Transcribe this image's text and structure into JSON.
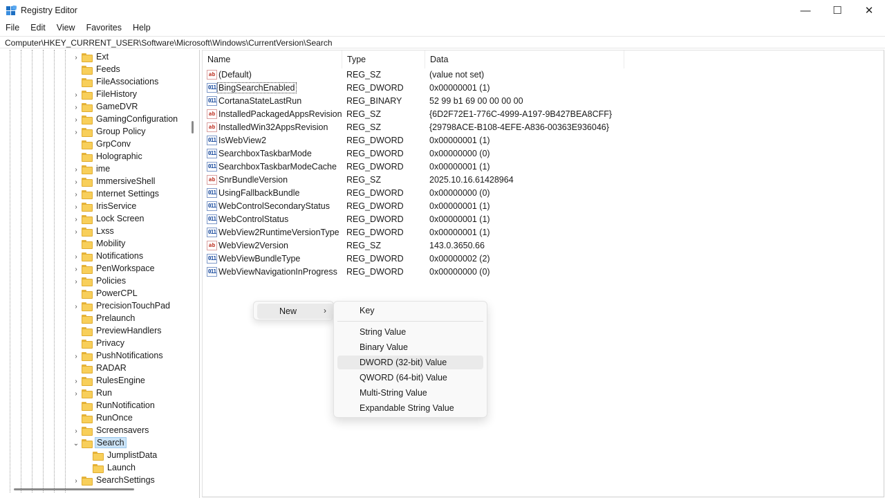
{
  "window": {
    "title": "Registry Editor",
    "controls": {
      "minimize": "—",
      "maximize": "☐",
      "close": "✕"
    }
  },
  "menubar": [
    "File",
    "Edit",
    "View",
    "Favorites",
    "Help"
  ],
  "address": "Computer\\HKEY_CURRENT_USER\\Software\\Microsoft\\Windows\\CurrentVersion\\Search",
  "tree": {
    "items": [
      {
        "label": "Ext",
        "expander": "›"
      },
      {
        "label": "Feeds",
        "expander": ""
      },
      {
        "label": "FileAssociations",
        "expander": ""
      },
      {
        "label": "FileHistory",
        "expander": "›"
      },
      {
        "label": "GameDVR",
        "expander": "›"
      },
      {
        "label": "GamingConfiguration",
        "expander": "›"
      },
      {
        "label": "Group Policy",
        "expander": "›"
      },
      {
        "label": "GrpConv",
        "expander": ""
      },
      {
        "label": "Holographic",
        "expander": ""
      },
      {
        "label": "ime",
        "expander": "›"
      },
      {
        "label": "ImmersiveShell",
        "expander": "›"
      },
      {
        "label": "Internet Settings",
        "expander": "›"
      },
      {
        "label": "IrisService",
        "expander": "›"
      },
      {
        "label": "Lock Screen",
        "expander": "›"
      },
      {
        "label": "Lxss",
        "expander": "›"
      },
      {
        "label": "Mobility",
        "expander": ""
      },
      {
        "label": "Notifications",
        "expander": "›"
      },
      {
        "label": "PenWorkspace",
        "expander": "›"
      },
      {
        "label": "Policies",
        "expander": "›"
      },
      {
        "label": "PowerCPL",
        "expander": ""
      },
      {
        "label": "PrecisionTouchPad",
        "expander": "›"
      },
      {
        "label": "Prelaunch",
        "expander": ""
      },
      {
        "label": "PreviewHandlers",
        "expander": ""
      },
      {
        "label": "Privacy",
        "expander": ""
      },
      {
        "label": "PushNotifications",
        "expander": "›"
      },
      {
        "label": "RADAR",
        "expander": ""
      },
      {
        "label": "RulesEngine",
        "expander": "›"
      },
      {
        "label": "Run",
        "expander": "›"
      },
      {
        "label": "RunNotification",
        "expander": ""
      },
      {
        "label": "RunOnce",
        "expander": ""
      },
      {
        "label": "Screensavers",
        "expander": "›"
      },
      {
        "label": "Search",
        "expander": "⌄",
        "selected": true
      },
      {
        "label": "JumplistData",
        "expander": "",
        "child": true
      },
      {
        "label": "Launch",
        "expander": "",
        "child": true
      },
      {
        "label": "SearchSettings",
        "expander": "›"
      }
    ]
  },
  "list": {
    "headers": {
      "name": "Name",
      "type": "Type",
      "data": "Data"
    },
    "rows": [
      {
        "icon": "ab",
        "kind": "sz",
        "name": "(Default)",
        "type": "REG_SZ",
        "data": "(value not set)"
      },
      {
        "icon": "011",
        "kind": "bin",
        "name": "BingSearchEnabled",
        "type": "REG_DWORD",
        "data": "0x00000001 (1)",
        "focused": true
      },
      {
        "icon": "011",
        "kind": "bin",
        "name": "CortanaStateLastRun",
        "type": "REG_BINARY",
        "data": "52 99 b1 69 00 00 00 00"
      },
      {
        "icon": "ab",
        "kind": "sz",
        "name": "InstalledPackagedAppsRevision",
        "type": "REG_SZ",
        "data": "{6D2F72E1-776C-4999-A197-9B427BEA8CFF}"
      },
      {
        "icon": "ab",
        "kind": "sz",
        "name": "InstalledWin32AppsRevision",
        "type": "REG_SZ",
        "data": "{29798ACE-B108-4EFE-A836-00363E936046}"
      },
      {
        "icon": "011",
        "kind": "bin",
        "name": "IsWebView2",
        "type": "REG_DWORD",
        "data": "0x00000001 (1)"
      },
      {
        "icon": "011",
        "kind": "bin",
        "name": "SearchboxTaskbarMode",
        "type": "REG_DWORD",
        "data": "0x00000000 (0)"
      },
      {
        "icon": "011",
        "kind": "bin",
        "name": "SearchboxTaskbarModeCache",
        "type": "REG_DWORD",
        "data": "0x00000001 (1)"
      },
      {
        "icon": "ab",
        "kind": "sz",
        "name": "SnrBundleVersion",
        "type": "REG_SZ",
        "data": "2025.10.16.61428964"
      },
      {
        "icon": "011",
        "kind": "bin",
        "name": "UsingFallbackBundle",
        "type": "REG_DWORD",
        "data": "0x00000000 (0)"
      },
      {
        "icon": "011",
        "kind": "bin",
        "name": "WebControlSecondaryStatus",
        "type": "REG_DWORD",
        "data": "0x00000001 (1)"
      },
      {
        "icon": "011",
        "kind": "bin",
        "name": "WebControlStatus",
        "type": "REG_DWORD",
        "data": "0x00000001 (1)"
      },
      {
        "icon": "011",
        "kind": "bin",
        "name": "WebView2RuntimeVersionType",
        "type": "REG_DWORD",
        "data": "0x00000001 (1)"
      },
      {
        "icon": "ab",
        "kind": "sz",
        "name": "WebView2Version",
        "type": "REG_SZ",
        "data": "143.0.3650.66"
      },
      {
        "icon": "011",
        "kind": "bin",
        "name": "WebViewBundleType",
        "type": "REG_DWORD",
        "data": "0x00000002 (2)"
      },
      {
        "icon": "011",
        "kind": "bin",
        "name": "WebViewNavigationInProgress",
        "type": "REG_DWORD",
        "data": "0x00000000 (0)"
      }
    ]
  },
  "context_menu": {
    "new_label": "New",
    "new_arrow": "›",
    "submenu": {
      "key": "Key",
      "items": [
        "String Value",
        "Binary Value",
        "DWORD (32-bit) Value",
        "QWORD (64-bit) Value",
        "Multi-String Value",
        "Expandable String Value"
      ],
      "hover_index": 2
    }
  }
}
